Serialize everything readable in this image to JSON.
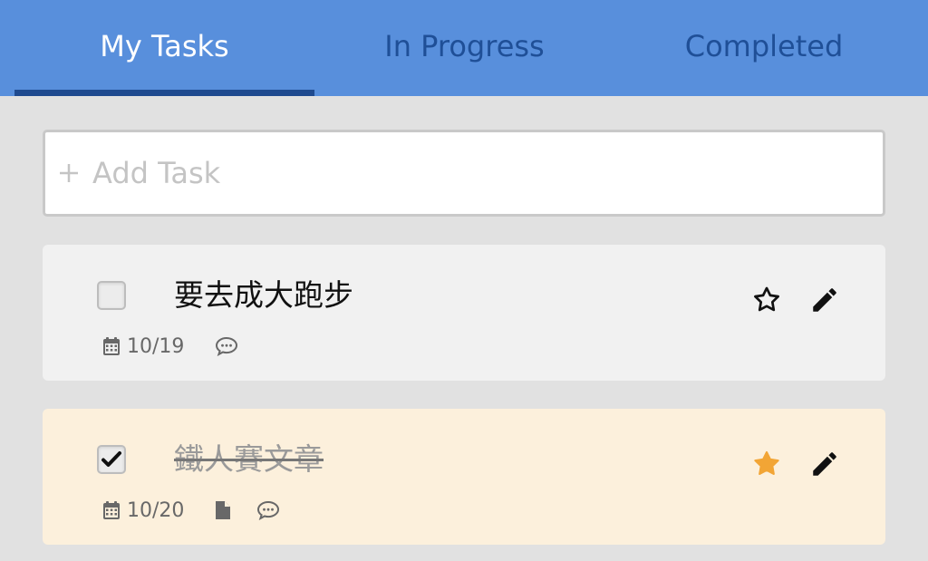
{
  "tabs": [
    {
      "label": "My Tasks",
      "active": true
    },
    {
      "label": "In Progress",
      "active": false
    },
    {
      "label": "Completed",
      "active": false
    }
  ],
  "add_task": {
    "placeholder": "Add Task",
    "icon": "plus-icon"
  },
  "tasks": [
    {
      "title": "要去成大跑步",
      "completed": false,
      "starred": false,
      "date": "10/19",
      "has_file": false,
      "has_comment": true
    },
    {
      "title": "鐵人賽文章",
      "completed": true,
      "starred": true,
      "date": "10/20",
      "has_file": true,
      "has_comment": true
    }
  ],
  "colors": {
    "header": "#588fdc",
    "active_tab_text": "#ffffff",
    "inactive_tab_text": "#1f4f97",
    "underline": "#1f4a8f",
    "starred": "#f2a535",
    "completed_card": "#fcf0dc",
    "default_card": "#f1f1f1"
  }
}
